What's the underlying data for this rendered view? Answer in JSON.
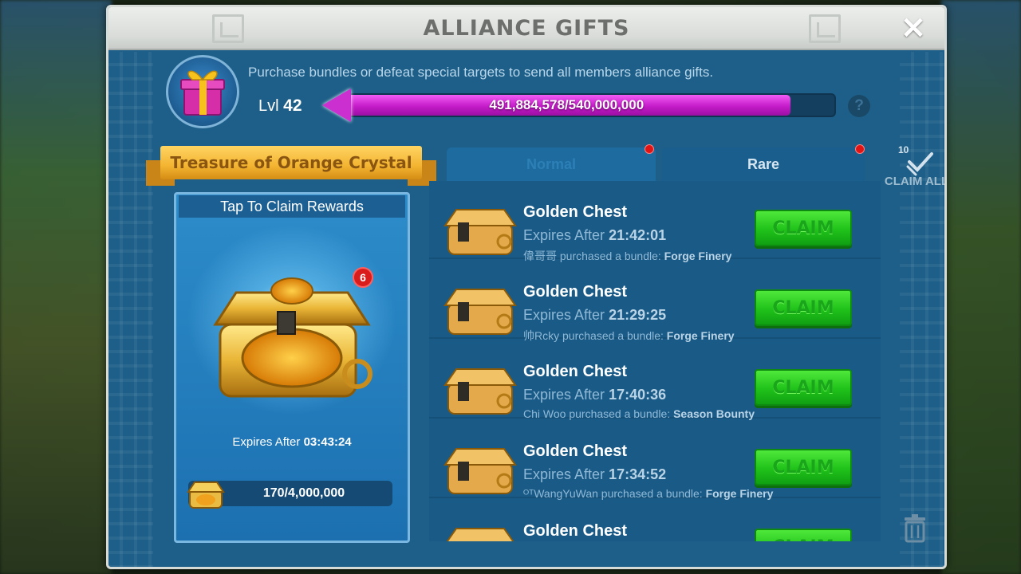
{
  "window": {
    "title": "ALLIANCE GIFTS"
  },
  "header": {
    "description": "Purchase bundles or defeat special targets to send all members alliance gifts.",
    "level_prefix": "Lvl",
    "level": "42",
    "progress_text": "491,884,578/540,000,000",
    "progress_fraction": 0.911,
    "help_label": "?"
  },
  "left_panel": {
    "ribbon_title": "Treasure of Orange Crystal",
    "tap_label": "Tap To Claim Rewards",
    "badge_count": "6",
    "expires_label": "Expires After",
    "expires_time": "03:43:24",
    "crystal_progress": "170/4,000,000"
  },
  "tabs": [
    {
      "label": "Normal",
      "active": false
    },
    {
      "label": "Rare",
      "active": true
    }
  ],
  "claim_all": {
    "count": "10",
    "label": "CLAIM ALL"
  },
  "gifts": [
    {
      "name": "Golden Chest",
      "expires_label": "Expires After",
      "time": "21:42:01",
      "buyer": "偉哥哥",
      "buyer_text": "purchased a bundle:",
      "bundle": "Forge Finery",
      "claim": "CLAIM"
    },
    {
      "name": "Golden Chest",
      "expires_label": "Expires After",
      "time": "21:29:25",
      "buyer": "帅Rcky",
      "buyer_text": "purchased a bundle:",
      "bundle": "Forge Finery",
      "claim": "CLAIM"
    },
    {
      "name": "Golden Chest",
      "expires_label": "Expires After",
      "time": "17:40:36",
      "buyer": "Chi Woo",
      "buyer_text": "purchased a bundle:",
      "bundle": "Season Bounty",
      "claim": "CLAIM"
    },
    {
      "name": "Golden Chest",
      "expires_label": "Expires After",
      "time": "17:34:52",
      "buyer": "ᴼᵀWangYuWan",
      "buyer_text": "purchased a bundle:",
      "bundle": "Forge Finery",
      "claim": "CLAIM"
    },
    {
      "name": "Golden Chest",
      "claim": "CLAIM"
    }
  ],
  "colors": {
    "panel_blue": "#1d5f88",
    "progress_magenta": "#c51cc9",
    "claim_green": "#20c21a",
    "ribbon_gold": "#f3b431"
  }
}
